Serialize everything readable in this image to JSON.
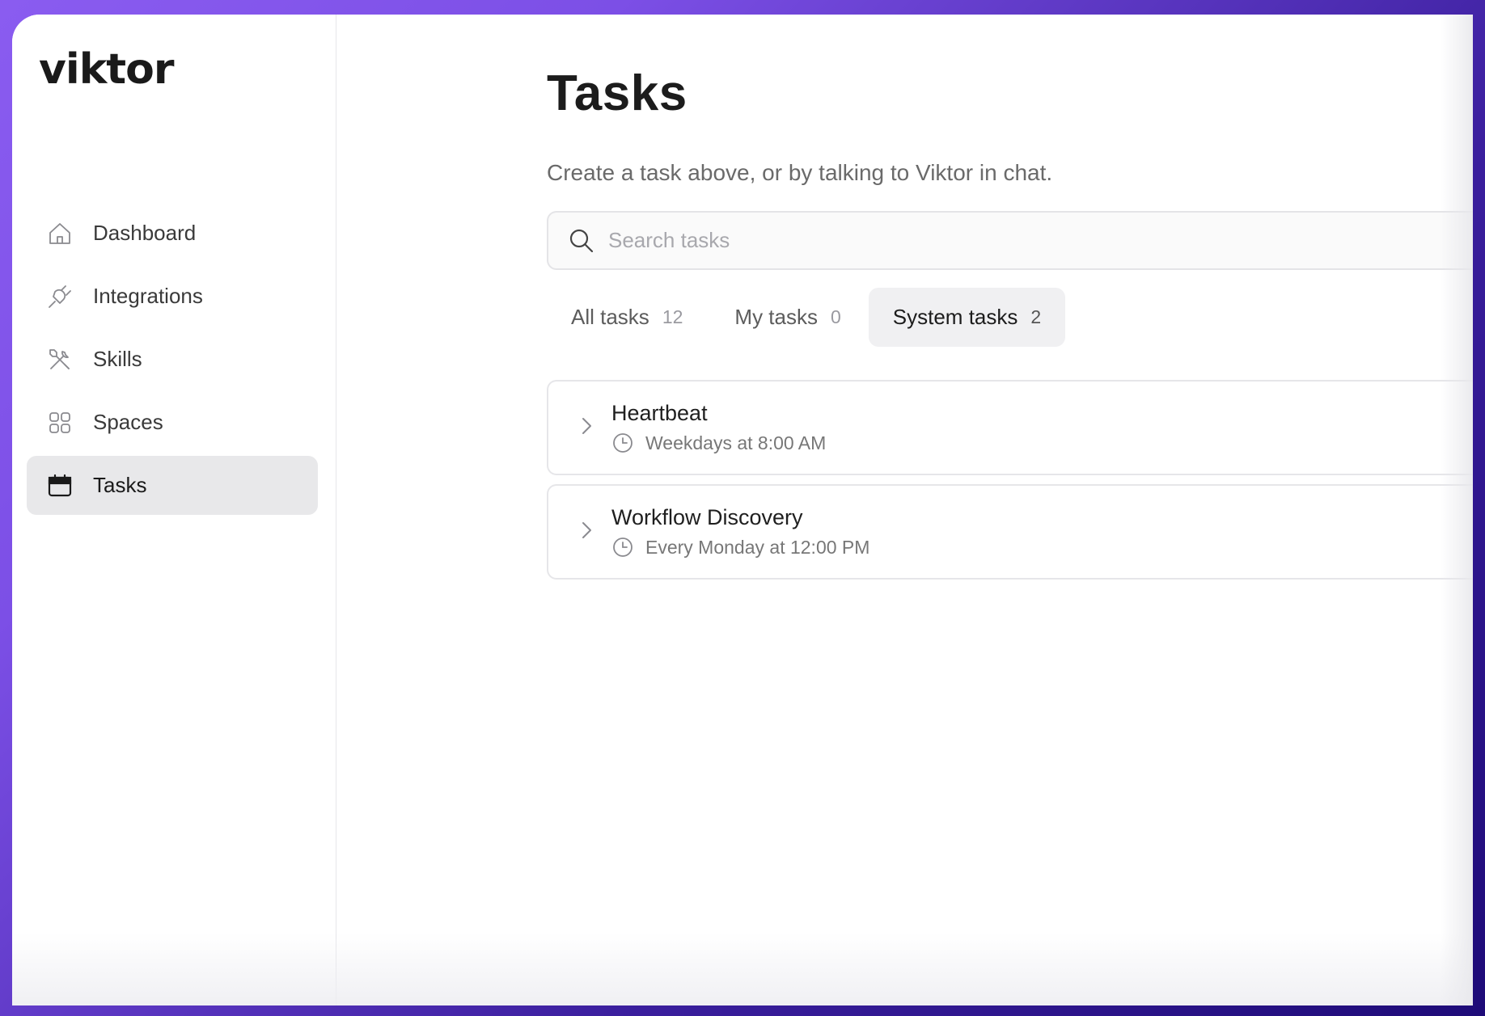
{
  "app": {
    "logo_text": "viktor"
  },
  "sidebar": {
    "items": [
      {
        "label": "Dashboard",
        "icon": "home-icon",
        "active": false
      },
      {
        "label": "Integrations",
        "icon": "plug-icon",
        "active": false
      },
      {
        "label": "Skills",
        "icon": "tools-icon",
        "active": false
      },
      {
        "label": "Spaces",
        "icon": "grid-icon",
        "active": false
      },
      {
        "label": "Tasks",
        "icon": "calendar-icon",
        "active": true
      }
    ]
  },
  "main": {
    "title": "Tasks",
    "subtitle": "Create a task above, or by talking to Viktor in chat.",
    "search": {
      "placeholder": "Search tasks",
      "value": ""
    },
    "tabs": [
      {
        "label": "All tasks",
        "count": "12",
        "active": false
      },
      {
        "label": "My tasks",
        "count": "0",
        "active": false
      },
      {
        "label": "System tasks",
        "count": "2",
        "active": true
      }
    ],
    "tasks": [
      {
        "name": "Heartbeat",
        "schedule": "Weekdays at 8:00 AM"
      },
      {
        "name": "Workflow Discovery",
        "schedule": "Every Monday at 12:00 PM"
      }
    ]
  },
  "colors": {
    "background_gradient_start": "#8a5cf0",
    "background_gradient_end": "#1e0b78",
    "active_nav_bg": "#e8e8ea",
    "active_tab_bg": "#f0f0f2"
  }
}
